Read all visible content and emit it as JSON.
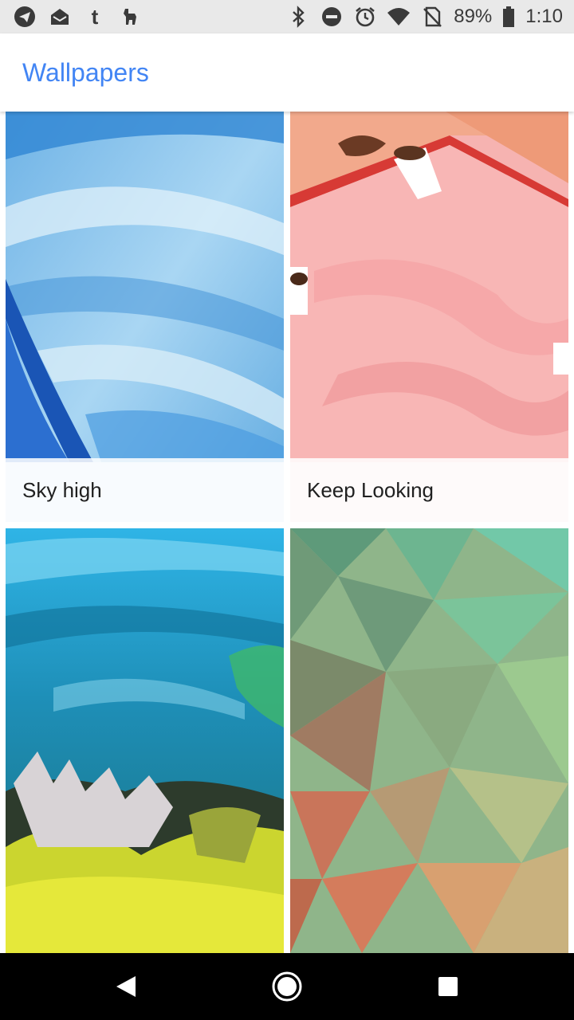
{
  "status_bar": {
    "battery_percent": "89%",
    "time": "1:10",
    "left_icons": [
      "telegram-icon",
      "mail-open-icon",
      "tumblr-icon",
      "wild-animal-icon"
    ],
    "right_icons": [
      "bluetooth-icon",
      "do-not-disturb-icon",
      "alarm-icon",
      "wifi-icon",
      "no-sim-icon",
      "battery-icon"
    ]
  },
  "app_bar": {
    "title": "Wallpapers",
    "title_color": "#4285f4"
  },
  "wallpapers": [
    {
      "label": "Sky high",
      "theme": "blue paint ocean"
    },
    {
      "label": "Keep Looking",
      "theme": "pink cloth coffee cups"
    },
    {
      "label": "",
      "theme": "coral reef underwater"
    },
    {
      "label": "",
      "theme": "green orange low-poly"
    }
  ],
  "nav_bar": {
    "buttons": [
      "back-icon",
      "home-icon",
      "recents-icon"
    ]
  }
}
